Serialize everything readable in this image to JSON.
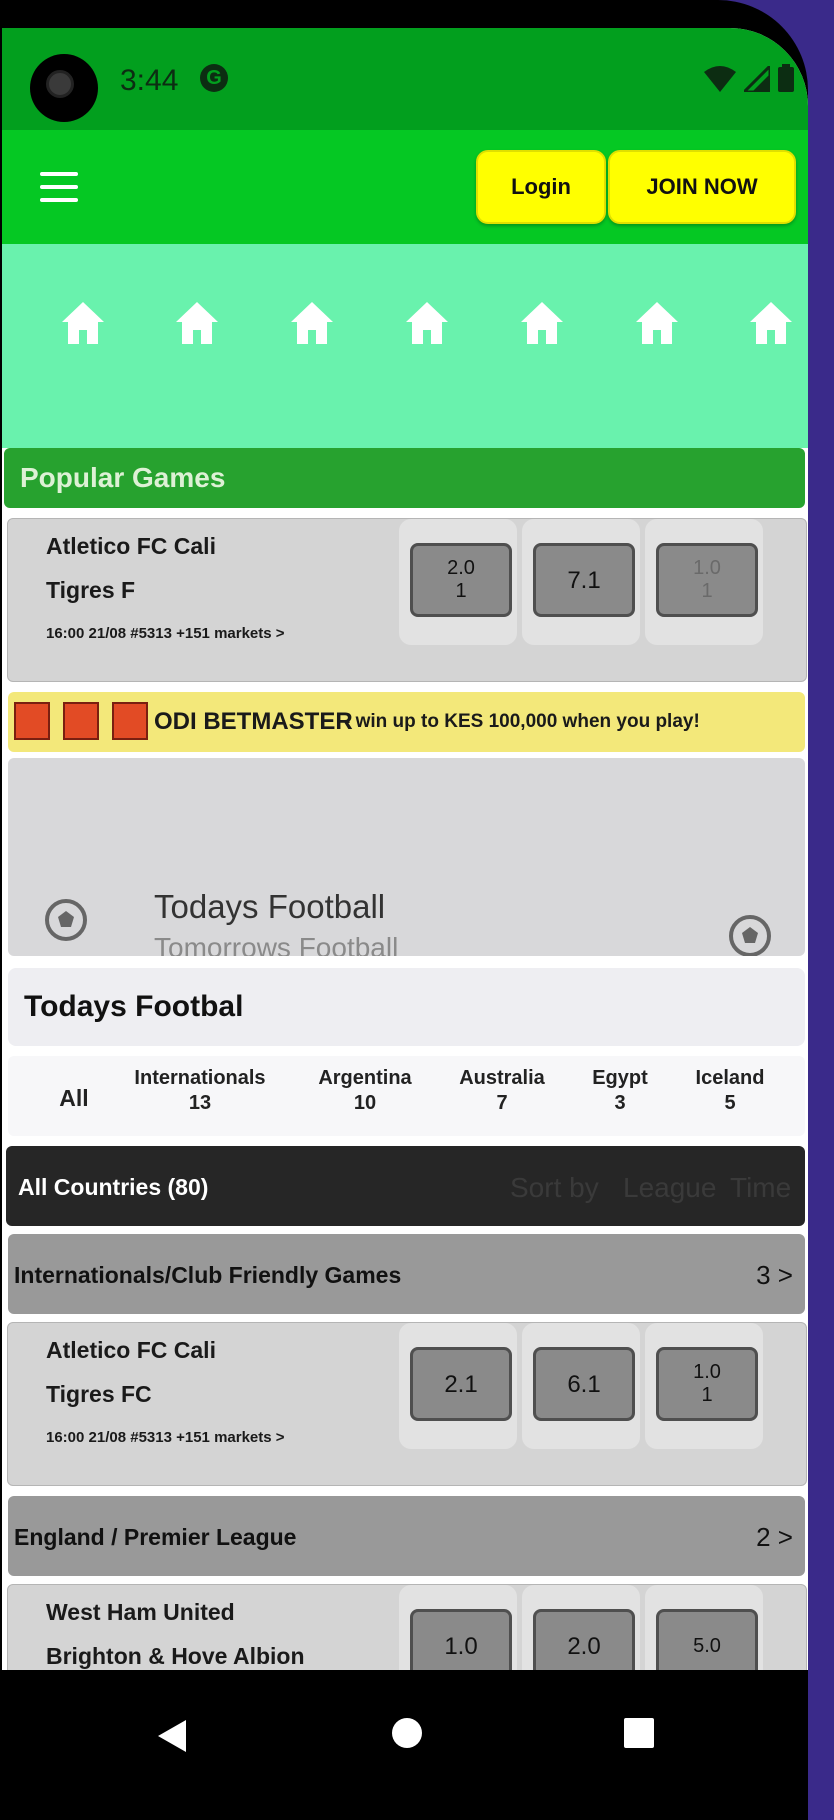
{
  "status_bar": {
    "time": "3:44",
    "icons": [
      "camera-icon",
      "google-icon",
      "wifi-icon",
      "signal-icon",
      "battery-icon"
    ]
  },
  "header": {
    "menu_icon": "hamburger-icon",
    "login_label": "Login",
    "join_label": "JOIN NOW"
  },
  "nav_strip": {
    "icons": [
      "home-icon",
      "home-icon",
      "home-icon",
      "home-icon",
      "home-icon",
      "home-icon",
      "home-icon"
    ]
  },
  "popular": {
    "title": "Popular Games",
    "match": {
      "home": "Atletico FC Cali",
      "away": "Tigres F",
      "meta": "16:00 21/08   #5313  +151 markets  >",
      "odds": [
        "2.0\n1",
        "7.1",
        "1.0\n1"
      ]
    }
  },
  "promo": {
    "title": "ODI BETMASTER",
    "text": "- win up to KES 100,000 when you play!"
  },
  "carousel": {
    "current": "Todays Football",
    "next": "Tomorrows Football"
  },
  "section_title": "Todays Footbal",
  "countries": [
    {
      "name": "All",
      "count": ""
    },
    {
      "name": "Internationals",
      "count": "13"
    },
    {
      "name": "Argentina",
      "count": "10"
    },
    {
      "name": "Australia",
      "count": "7"
    },
    {
      "name": "Egypt",
      "count": "3"
    },
    {
      "name": "Iceland",
      "count": "5"
    }
  ],
  "list_header": {
    "all_label": "All Countries (80)",
    "sort_label": "Sort by",
    "league_label": "League",
    "time_label": "Time"
  },
  "leagues": [
    {
      "name": "Internationals/Club Friendly Games",
      "count": "3 >",
      "match": {
        "home": "Atletico FC Cali",
        "away": "Tigres FC",
        "meta": "16:00 21/08   #5313  +151 markets  >",
        "odds": [
          "2.1",
          "6.1",
          "1.0\n1"
        ]
      }
    },
    {
      "name": "England / Premier League",
      "count": "2 >",
      "match": {
        "home": "West Ham United",
        "away": "Brighton & Hove Albion",
        "odds": [
          "1.0",
          "2.0",
          "5.0"
        ]
      }
    }
  ],
  "colors": {
    "status": "#029f1e",
    "header": "#05c823",
    "nav": "#69f2ad",
    "button": "#ffff00",
    "popular": "#27a22f",
    "promo": "#f3e87a"
  }
}
